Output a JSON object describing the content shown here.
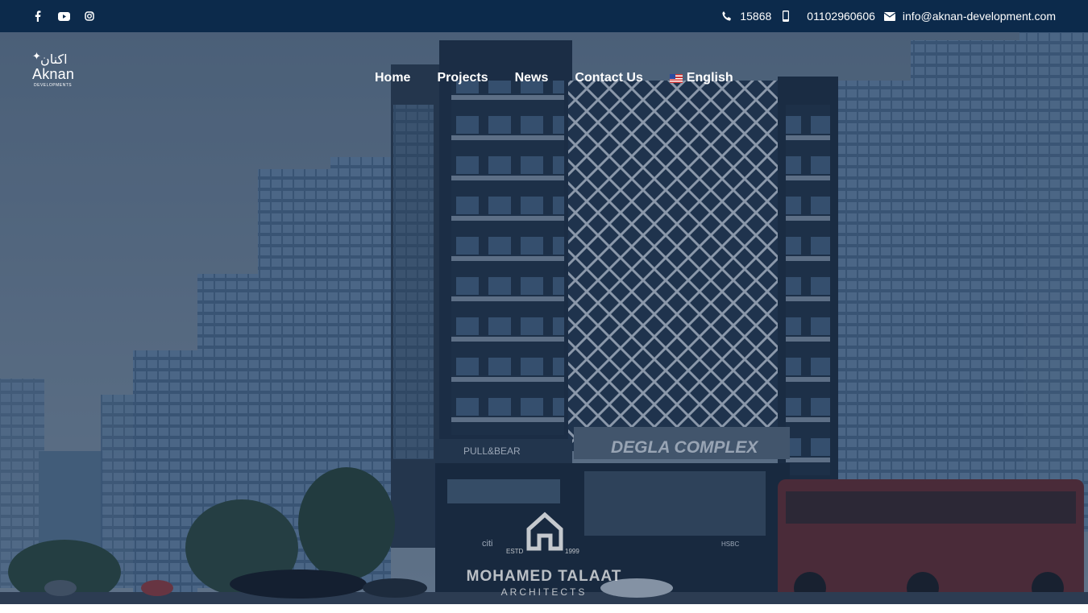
{
  "topbar": {
    "social": [
      {
        "icon": "facebook-icon"
      },
      {
        "icon": "youtube-icon"
      },
      {
        "icon": "instagram-icon"
      }
    ],
    "hotline": "15868",
    "mobile": "01102960606",
    "email": "info@aknan-development.com"
  },
  "logo": {
    "arabic": "اكنان",
    "english": "Aknan",
    "sub": "DEVELOPMENTS"
  },
  "nav": {
    "items": [
      "Home",
      "Projects",
      "News",
      "Contact Us"
    ],
    "language": "English"
  },
  "hero": {
    "signage": {
      "complex": "DEGLA COMPLEX",
      "store": "PULL&BEAR",
      "bank": "citi",
      "bank2": "HSBC"
    },
    "watermark": {
      "estd": "ESTD",
      "year": "1999",
      "name": "MOHAMED TALAAT",
      "sub": "ARCHITECTS"
    }
  },
  "colors": {
    "topbar": "#0c2a4b",
    "overlay": "#162c4e",
    "text": "#ffffff"
  }
}
